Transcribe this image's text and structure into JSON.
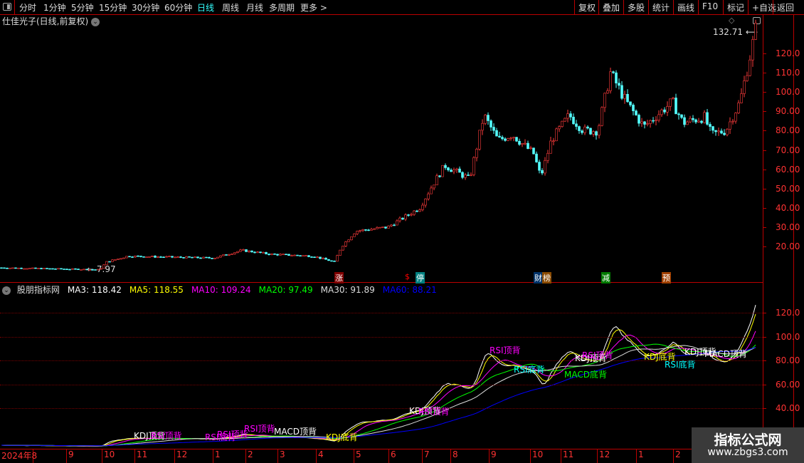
{
  "toolbar": {
    "periods": [
      "分时",
      "1分钟",
      "5分钟",
      "15分钟",
      "30分钟",
      "60分钟",
      "日线",
      "周线",
      "月线",
      "多周期",
      "更多 >"
    ],
    "active_period": "日线",
    "right_buttons": [
      "复权",
      "叠加",
      "多股",
      "统计",
      "画线",
      "F10",
      "标记",
      "+自选",
      "返回"
    ]
  },
  "main": {
    "title": "仕佳光子(日线,前复权)",
    "high_label": "132.71",
    "low_label": "7.97",
    "y_axis": [
      "120.0",
      "110.0",
      "100.0",
      "90.00",
      "80.00",
      "70.00",
      "60.00",
      "50.00",
      "40.00",
      "30.00",
      "20.00"
    ],
    "events": [
      {
        "label": "涨",
        "color": "#800000"
      },
      {
        "label": "$",
        "color": "#000000"
      },
      {
        "label": "停",
        "color": "#008080"
      },
      {
        "label": "财",
        "color": "#00336a"
      },
      {
        "label": "榜",
        "color": "#8a4a00"
      },
      {
        "label": "减",
        "color": "#007a00"
      },
      {
        "label": "预",
        "color": "#a04000"
      }
    ]
  },
  "indicator": {
    "name": "股朋指标网",
    "ma": [
      {
        "label": "MA3: 118.42",
        "color": "#ffffff"
      },
      {
        "label": "MA5: 118.55",
        "color": "#ffff00"
      },
      {
        "label": "MA10: 109.24",
        "color": "#ff00ff"
      },
      {
        "label": "MA20: 97.49",
        "color": "#00ff00"
      },
      {
        "label": "MA30: 91.89",
        "color": "#dddddd"
      },
      {
        "label": "MA60: 88.21",
        "color": "#0000ff"
      }
    ],
    "y_axis": [
      "120.0",
      "100.0",
      "80.00",
      "60.00",
      "40.00"
    ],
    "signals": [
      {
        "text": "KDJ顶背",
        "color": "#ffffff"
      },
      {
        "text": "RSI顶背",
        "color": "#ff00ff"
      },
      {
        "text": "RSI底背",
        "color": "#ff00ff"
      },
      {
        "text": "RSI顶背",
        "color": "#ff00ff"
      },
      {
        "text": "MACD顶背",
        "color": "#ffffff"
      },
      {
        "text": "KDJ底背",
        "color": "#ffff00"
      },
      {
        "text": "RSI顶背",
        "color": "#ff00ff"
      },
      {
        "text": "KDJ顶背",
        "color": "#ffffff"
      },
      {
        "text": "RSI顶背",
        "color": "#ff00ff"
      },
      {
        "text": "RSI底背",
        "color": "#00ffff"
      },
      {
        "text": "MACD底背",
        "color": "#00ff00"
      },
      {
        "text": "KDJ顶背",
        "color": "#ffffff"
      },
      {
        "text": "RSI顶背",
        "color": "#ff00ff"
      },
      {
        "text": "KDJ底背",
        "color": "#ffff00"
      },
      {
        "text": "RSI底背",
        "color": "#00ffff"
      },
      {
        "text": "KDJ顶背",
        "color": "#ffffff"
      },
      {
        "text": "MACD顶背",
        "color": "#ffffff"
      },
      {
        "text": "RSI顶背",
        "color": "#ff00ff"
      }
    ]
  },
  "date_axis": [
    "2024年8",
    "9",
    "10",
    "11",
    "12",
    "1",
    "2",
    "3",
    "4",
    "5",
    "6",
    "7",
    "8",
    "9",
    "10",
    "11",
    "12",
    "1",
    "2"
  ],
  "watermark": {
    "line1": "指标公式网",
    "line2": "www.zbgs3.com"
  },
  "price_path": [
    [
      0,
      9
    ],
    [
      140,
      7.97
    ],
    [
      150,
      12
    ],
    [
      180,
      15
    ],
    [
      300,
      14
    ],
    [
      340,
      18
    ],
    [
      380,
      16
    ],
    [
      440,
      15
    ],
    [
      470,
      12
    ],
    [
      480,
      20
    ],
    [
      500,
      28
    ],
    [
      545,
      30
    ],
    [
      590,
      40
    ],
    [
      605,
      50
    ],
    [
      625,
      62
    ],
    [
      660,
      55
    ],
    [
      680,
      88
    ],
    [
      700,
      75
    ],
    [
      720,
      78
    ],
    [
      750,
      68
    ],
    [
      760,
      56
    ],
    [
      775,
      75
    ],
    [
      800,
      88
    ],
    [
      820,
      80
    ],
    [
      840,
      80
    ],
    [
      858,
      110
    ],
    [
      880,
      95
    ],
    [
      905,
      82
    ],
    [
      945,
      95
    ],
    [
      960,
      84
    ],
    [
      990,
      87
    ],
    [
      1000,
      78
    ],
    [
      1020,
      80
    ],
    [
      1040,
      95
    ],
    [
      1055,
      120
    ],
    [
      1062,
      132.71
    ]
  ]
}
